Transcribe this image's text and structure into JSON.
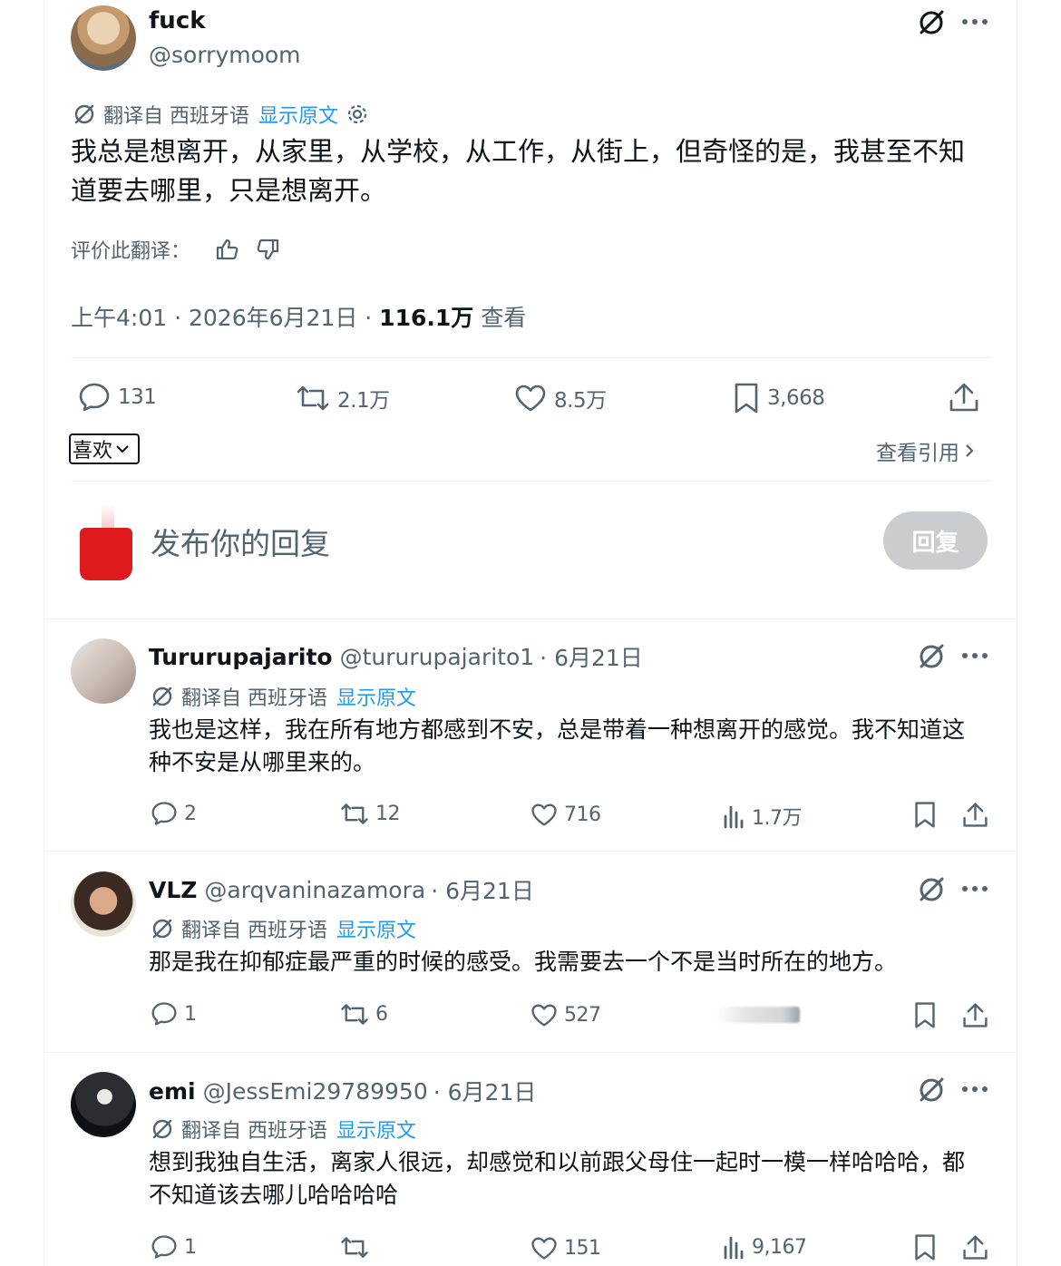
{
  "main_tweet": {
    "display_name": "fuck",
    "handle": "@sorrymoom",
    "translated_from": "翻译自 西班牙语",
    "show_original": "显示原文",
    "text": "我总是想离开，从家里，从学校，从工作，从街上，但奇怪的是，我甚至不知道要去哪里，只是想离开。",
    "rate_label": "评价此翻译：",
    "time": "上午4:01 · 2026年6月21日 · ",
    "views": "116.1万",
    "views_label": " 查看",
    "replies": "131",
    "retweets": "2.1万",
    "likes": "8.5万",
    "bookmarks": "3,668",
    "sort_label": "喜欢",
    "view_quotes": "查看引用"
  },
  "composer": {
    "placeholder": "发布你的回复",
    "reply_button": "回复"
  },
  "replies": [
    {
      "display_name": "Tururupajarito",
      "handle": "@tururupajarito1",
      "date": "· 6月21日",
      "translated_from": "翻译自 西班牙语",
      "show_original": "显示原文",
      "text": "我也是这样，我在所有地方都感到不安，总是带着一种想离开的感觉。我不知道这种不安是从哪里来的。",
      "replies": "2",
      "retweets": "12",
      "likes": "716",
      "views": "1.7万"
    },
    {
      "display_name": "VLZ",
      "handle": "@arqvaninazamora",
      "date": "· 6月21日",
      "translated_from": "翻译自 西班牙语",
      "show_original": "显示原文",
      "text": "那是我在抑郁症最严重的时候的感受。我需要去一个不是当时所在的地方。",
      "replies": "1",
      "retweets": "6",
      "likes": "527",
      "views": ""
    },
    {
      "display_name": "emi",
      "handle": "@JessEmi29789950",
      "date": "· 6月21日",
      "translated_from": "翻译自 西班牙语",
      "show_original": "显示原文",
      "text": "想到我独自生活，离家人很远，却感觉和以前跟父母住一起时一模一样哈哈哈，都不知道该去哪儿哈哈哈哈",
      "replies": "1",
      "retweets": "",
      "likes": "151",
      "views": "9,167"
    }
  ],
  "colors": {
    "accent": "#1d9bf0",
    "muted": "#536471",
    "text": "#0f1419",
    "divider": "#eff3f4",
    "reply_button_bg": "#c9cdd0"
  },
  "icons": [
    "grok-icon",
    "more-icon",
    "translate-icon",
    "settings-icon",
    "thumbs-up-icon",
    "thumbs-down-icon",
    "reply-icon",
    "retweet-icon",
    "like-icon",
    "bookmark-icon",
    "share-icon",
    "views-icon",
    "chevron-down-icon",
    "chevron-right-icon"
  ]
}
